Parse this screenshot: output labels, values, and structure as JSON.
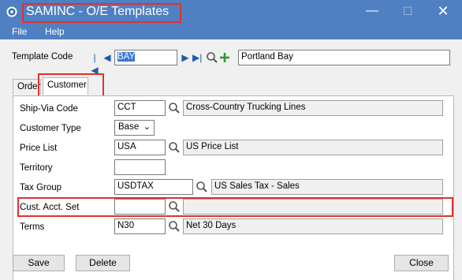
{
  "window": {
    "title": "SAMINC - O/E Templates",
    "minimize": "—",
    "maximize": "☐",
    "close": "✕"
  },
  "menu": {
    "file": "File",
    "help": "Help"
  },
  "template": {
    "label": "Template Code",
    "code": "BAY",
    "description": "Portland Bay"
  },
  "tabs": {
    "order": "Order",
    "customer": "Customer"
  },
  "customer": {
    "ship_via": {
      "label": "Ship-Via Code",
      "code": "CCT",
      "description": "Cross-Country Trucking Lines"
    },
    "customer_type": {
      "label": "Customer Type",
      "value": "Base"
    },
    "price_list": {
      "label": "Price List",
      "code": "USA",
      "description": "US Price List"
    },
    "territory": {
      "label": "Territory",
      "value": ""
    },
    "tax_group": {
      "label": "Tax Group",
      "code": "USDTAX",
      "description": "US Sales Tax - Sales"
    },
    "acct_set": {
      "label": "Cust. Acct. Set",
      "code": "",
      "description": ""
    },
    "terms": {
      "label": "Terms",
      "code": "N30",
      "description": "Net 30 Days"
    }
  },
  "buttons": {
    "save": "Save",
    "delete": "Delete",
    "close": "Close"
  },
  "colors": {
    "titlebar": "#4f80c2",
    "highlight": "#e03030",
    "nav": "#1e5aa8",
    "add": "#2e9a2e"
  }
}
